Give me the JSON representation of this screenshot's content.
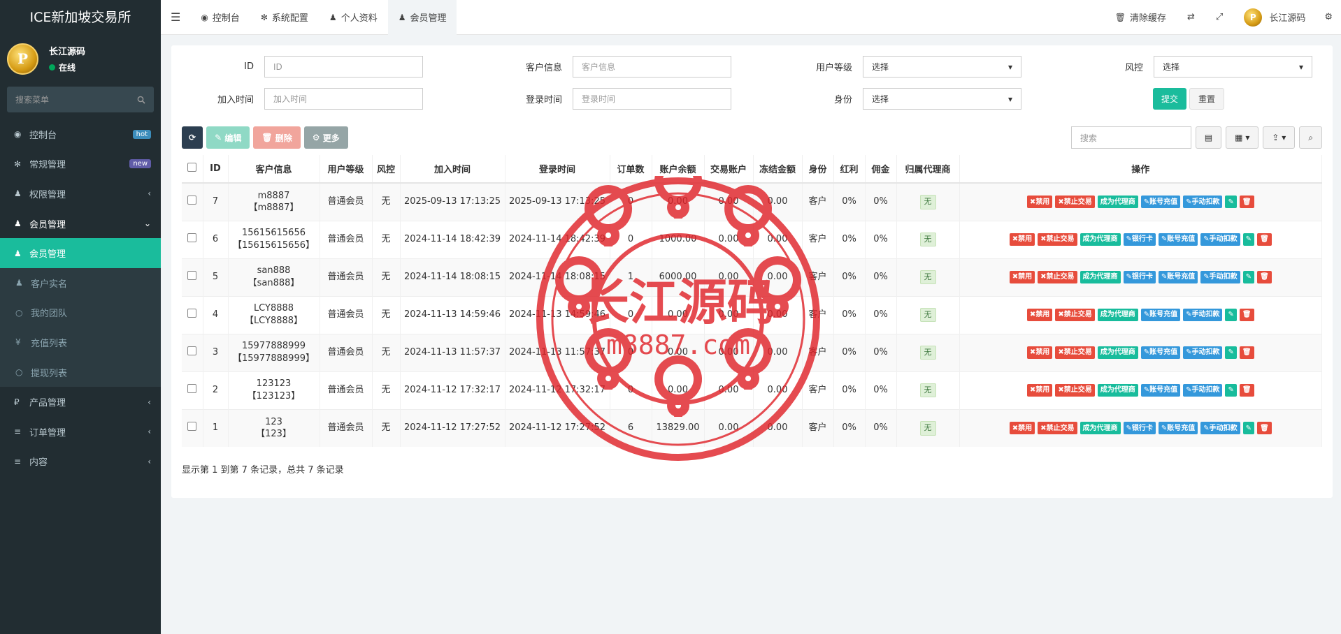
{
  "app_title": "ICE新加坡交易所",
  "user": {
    "name": "长江源码",
    "status": "在线"
  },
  "sidebar": {
    "search_placeholder": "搜索菜单",
    "items": [
      {
        "label": "控制台",
        "icon": "dashboard-icon",
        "badge": "hot"
      },
      {
        "label": "常规管理",
        "icon": "cogs-icon",
        "badge": "new"
      },
      {
        "label": "权限管理",
        "icon": "group-icon"
      },
      {
        "label": "会员管理",
        "icon": "user-icon"
      },
      {
        "label": "会员管理",
        "icon": "user-icon",
        "active": true
      },
      {
        "label": "客户实名",
        "icon": "user-icon"
      },
      {
        "label": "我的团队",
        "icon": "circle-icon"
      },
      {
        "label": "充值列表",
        "icon": "yen-icon"
      },
      {
        "label": "提现列表",
        "icon": "circle-icon"
      },
      {
        "label": "产品管理",
        "icon": "ruble-icon"
      },
      {
        "label": "订单管理",
        "icon": "list-icon"
      },
      {
        "label": "内容",
        "icon": "list-icon"
      }
    ]
  },
  "topbar": {
    "tabs": [
      "控制台",
      "系统配置",
      "个人资料",
      "会员管理"
    ],
    "clear_cache": "清除缓存",
    "user_name": "长江源码"
  },
  "filters": {
    "id_label": "ID",
    "id_placeholder": "ID",
    "customer_label": "客户信息",
    "customer_placeholder": "客户信息",
    "level_label": "用户等级",
    "level_value": "选择",
    "risk_label": "风控",
    "risk_value": "选择",
    "join_label": "加入时间",
    "join_placeholder": "加入时间",
    "login_label": "登录时间",
    "login_placeholder": "登录时间",
    "role_label": "身份",
    "role_value": "选择",
    "submit": "提交",
    "reset": "重置"
  },
  "toolbar": {
    "edit": "编辑",
    "delete": "删除",
    "more": "更多",
    "search_placeholder": "搜索"
  },
  "table": {
    "columns": [
      "ID",
      "客户信息",
      "用户等级",
      "风控",
      "加入时间",
      "登录时间",
      "订单数",
      "账户余额",
      "交易账户",
      "冻结金额",
      "身份",
      "红利",
      "佣金",
      "归属代理商",
      "操作"
    ],
    "rows": [
      {
        "id": "7",
        "info1": "m8887",
        "info2": "【m8887】",
        "level": "普通会员",
        "risk": "无",
        "join": "2025-09-13 17:13:25",
        "login": "2025-09-13 17:13:25",
        "orders": "0",
        "balance": "0.00",
        "trade": "0.00",
        "frozen": "0.00",
        "role": "客户",
        "bonus": "0%",
        "comm": "0%",
        "agent": "无",
        "bank": false
      },
      {
        "id": "6",
        "info1": "15615615656",
        "info2": "【15615615656】",
        "level": "普通会员",
        "risk": "无",
        "join": "2024-11-14 18:42:39",
        "login": "2024-11-14 18:42:39",
        "orders": "0",
        "balance": "1000.00",
        "trade": "0.00",
        "frozen": "0.00",
        "role": "客户",
        "bonus": "0%",
        "comm": "0%",
        "agent": "无",
        "bank": true
      },
      {
        "id": "5",
        "info1": "san888",
        "info2": "【san888】",
        "level": "普通会员",
        "risk": "无",
        "join": "2024-11-14 18:08:15",
        "login": "2024-11-14 18:08:15",
        "orders": "1",
        "balance": "6000.00",
        "trade": "0.00",
        "frozen": "0.00",
        "role": "客户",
        "bonus": "0%",
        "comm": "0%",
        "agent": "无",
        "bank": true
      },
      {
        "id": "4",
        "info1": "LCY8888",
        "info2": "【LCY8888】",
        "level": "普通会员",
        "risk": "无",
        "join": "2024-11-13 14:59:46",
        "login": "2024-11-13 14:59:46",
        "orders": "0",
        "balance": "0.00",
        "trade": "0.00",
        "frozen": "0.00",
        "role": "客户",
        "bonus": "0%",
        "comm": "0%",
        "agent": "无",
        "bank": false
      },
      {
        "id": "3",
        "info1": "15977888999",
        "info2": "【15977888999】",
        "level": "普通会员",
        "risk": "无",
        "join": "2024-11-13 11:57:37",
        "login": "2024-11-13 11:57:37",
        "orders": "0",
        "balance": "0.00",
        "trade": "0.00",
        "frozen": "0.00",
        "role": "客户",
        "bonus": "0%",
        "comm": "0%",
        "agent": "无",
        "bank": false
      },
      {
        "id": "2",
        "info1": "123123",
        "info2": "【123123】",
        "level": "普通会员",
        "risk": "无",
        "join": "2024-11-12 17:32:17",
        "login": "2024-11-12 17:32:17",
        "orders": "0",
        "balance": "0.00",
        "trade": "0.00",
        "frozen": "0.00",
        "role": "客户",
        "bonus": "0%",
        "comm": "0%",
        "agent": "无",
        "bank": false
      },
      {
        "id": "1",
        "info1": "123",
        "info2": "【123】",
        "level": "普通会员",
        "risk": "无",
        "join": "2024-11-12 17:27:52",
        "login": "2024-11-12 17:27:52",
        "orders": "6",
        "balance": "13829.00",
        "trade": "0.00",
        "frozen": "0.00",
        "role": "客户",
        "bonus": "0%",
        "comm": "0%",
        "agent": "无",
        "bank": true
      }
    ],
    "actions": {
      "disable": "禁用",
      "no_trade": "禁止交易",
      "make_agent": "成为代理商",
      "bank": "银行卡",
      "recharge": "账号充值",
      "deduct": "手动扣款"
    }
  },
  "pager_text": "显示第 1 到第 7 条记录，总共 7 条记录",
  "watermark": {
    "title": "长江源码",
    "url": "m8887.com"
  },
  "colors": {
    "sidebar_bg": "#222d32",
    "accent": "#1abc9c",
    "danger": "#e74c3c",
    "info": "#3498db"
  }
}
